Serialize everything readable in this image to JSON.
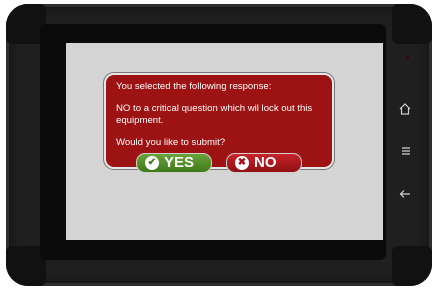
{
  "dialog": {
    "line1": "You selected the following response:",
    "line2": "NO to a critical question which wil lock out this equipment.",
    "line3": "Would you like to submit?"
  },
  "buttons": {
    "yes_label": "YES",
    "no_label": "NO",
    "yes_icon": "check-circle-icon",
    "no_icon": "x-circle-icon"
  },
  "nav": {
    "home_icon": "home-icon",
    "menu_icon": "menu-icon",
    "back_icon": "back-icon"
  },
  "colors": {
    "dialog_bg": "#9d1212",
    "yes_bg": "#4f8e28",
    "no_bg": "#b0161c",
    "screen_bg": "#d4d4d4"
  }
}
